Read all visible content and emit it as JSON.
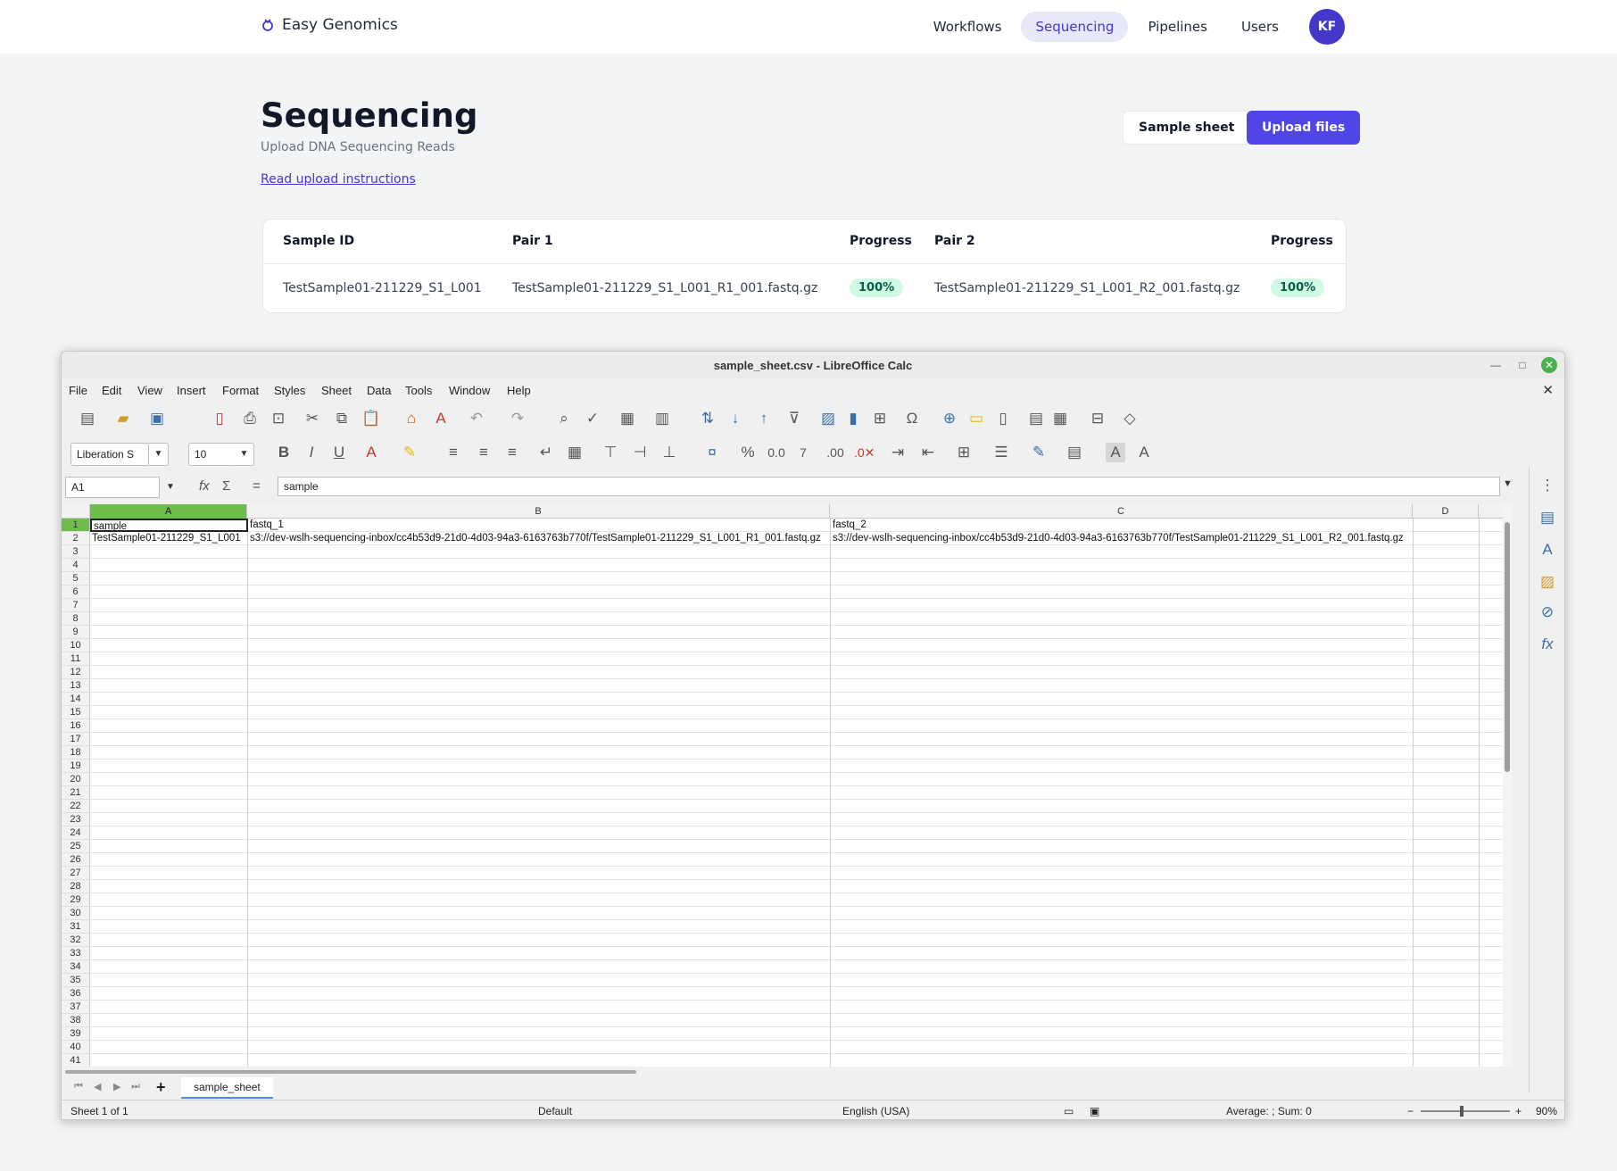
{
  "app": {
    "brand": "Easy Genomics",
    "nav": [
      "Workflows",
      "Sequencing",
      "Pipelines",
      "Users"
    ],
    "active_nav": "Sequencing",
    "avatar_initials": "KF",
    "title": "Sequencing",
    "subtitle": "Upload DNA Sequencing Reads",
    "instructions_link": "Read upload instructions",
    "buttons": {
      "sample_sheet": "Sample sheet",
      "upload_files": "Upload files"
    },
    "table": {
      "headers": [
        "Sample ID",
        "Pair 1",
        "Progress",
        "Pair 2",
        "Progress"
      ],
      "rows": [
        {
          "sample_id": "TestSample01-211229_S1_L001",
          "pair1": "TestSample01-211229_S1_L001_R1_001.fastq.gz",
          "progress1": "100%",
          "pair2": "TestSample01-211229_S1_L001_R2_001.fastq.gz",
          "progress2": "100%"
        }
      ]
    },
    "colors": {
      "accent": "#4f46e5",
      "badge_bg": "#d1fae5",
      "badge_fg": "#065f46"
    }
  },
  "calc": {
    "window_title": "sample_sheet.csv - LibreOffice Calc",
    "menu": [
      "File",
      "Edit",
      "View",
      "Insert",
      "Format",
      "Styles",
      "Sheet",
      "Data",
      "Tools",
      "Window",
      "Help"
    ],
    "font_name": "Liberation S",
    "font_size": "10",
    "name_box": "A1",
    "formula_value": "sample",
    "columns": [
      "A",
      "B",
      "C",
      "D"
    ],
    "active_column": "A",
    "rows": 41,
    "cells": {
      "A1": "sample",
      "B1": "fastq_1",
      "C1": "fastq_2",
      "A2": "TestSample01-211229_S1_L001",
      "B2": "s3://dev-wslh-sequencing-inbox/cc4b53d9-21d0-4d03-94a3-6163763b770f/TestSample01-211229_S1_L001_R1_001.fastq.gz",
      "C2": "s3://dev-wslh-sequencing-inbox/cc4b53d9-21d0-4d03-94a3-6163763b770f/TestSample01-211229_S1_L001_R2_001.fastq.gz"
    },
    "sheet_tab": "sample_sheet",
    "status": {
      "sheet": "Sheet 1 of 1",
      "style": "Default",
      "language": "English (USA)",
      "summary": "Average: ; Sum: 0",
      "zoom": "90%"
    },
    "icons": {
      "toolbar1": [
        "new-icon",
        "open-icon",
        "save-icon",
        "export-pdf-icon",
        "print-icon",
        "print-preview-icon",
        "cut-icon",
        "copy-icon",
        "paste-icon",
        "clone-formatting-icon",
        "clear-formatting-icon",
        "undo-icon",
        "redo-icon",
        "find-replace-icon",
        "spelling-icon",
        "row-icon",
        "column-icon",
        "sort-icon",
        "sort-ascending-icon",
        "sort-descending-icon",
        "autofilter-icon",
        "insert-image-icon",
        "insert-chart-icon",
        "pivot-table-icon",
        "special-character-icon",
        "hyperlink-icon",
        "comment-icon",
        "header-footer-icon",
        "define-print-area-icon",
        "freeze-rows-icon",
        "split-window-icon",
        "show-draw-functions-icon"
      ],
      "sidebar": [
        "properties-icon",
        "styles-icon",
        "gallery-icon",
        "navigator-icon",
        "functions-icon"
      ]
    }
  }
}
